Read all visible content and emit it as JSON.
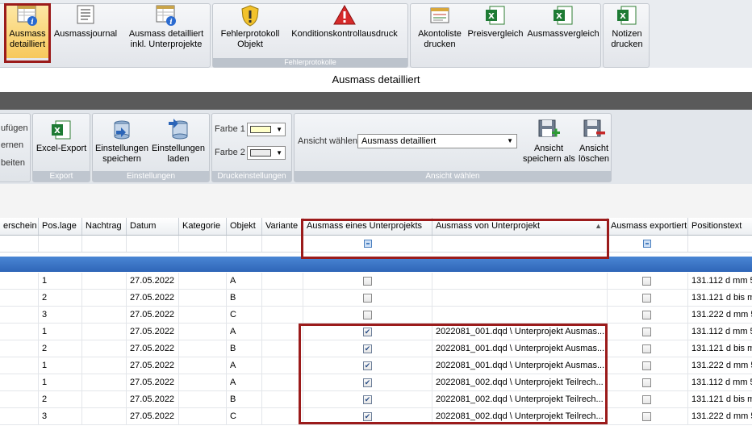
{
  "ribbon_top": {
    "buttons": [
      {
        "id": "ausmass-detailliert",
        "label": "Ausmass\ndetailliert",
        "icon": "report-info-icon",
        "selected": true
      },
      {
        "id": "ausmassjournal",
        "label": "Ausmassjournal",
        "icon": "journal-list-icon"
      },
      {
        "id": "ausmass-detailliert-unterprojekte",
        "label": "Ausmass detailliert\ninkl. Unterprojekte",
        "icon": "report-info-icon"
      },
      {
        "id": "fehlerprotokoll-objekt",
        "label": "Fehlerprotokoll\nObjekt",
        "icon": "warning-shield-icon"
      },
      {
        "id": "konditionskontrollausdruck",
        "label": "Konditionskontrollausdruck",
        "icon": "warning-triangle-icon"
      },
      {
        "id": "akontoliste-drucken",
        "label": "Akontoliste\ndrucken",
        "icon": "list-print-icon"
      },
      {
        "id": "preisvergleich",
        "label": "Preisvergleich",
        "icon": "excel-icon"
      },
      {
        "id": "ausmassvergleich",
        "label": "Ausmassvergleich",
        "icon": "excel-icon"
      },
      {
        "id": "notizen-drucken",
        "label": "Notizen\ndrucken",
        "icon": "excel-icon"
      }
    ],
    "group_titles": {
      "fehlerprotokolle": "Fehlerprotokolle"
    }
  },
  "view_title": "Ausmass detailliert",
  "ribbon_second": {
    "partial_items": [
      "ufügen",
      "ernen",
      "beiten"
    ],
    "export": {
      "button": "Excel-Export",
      "group": "Export"
    },
    "einstellungen": {
      "save": "Einstellungen\nspeichern",
      "load": "Einstellungen\nladen",
      "group": "Einstellungen"
    },
    "druck": {
      "farbe1": "Farbe 1",
      "farbe2": "Farbe 2",
      "group": "Druckeinstellungen",
      "color1": "#ffffc8",
      "color2": "#ececec"
    },
    "ansicht": {
      "label": "Ansicht wählen",
      "selected": "Ausmass detailliert",
      "save": "Ansicht\nspeichern als",
      "delete": "Ansicht\nlöschen",
      "group": "Ansicht wählen"
    }
  },
  "grid": {
    "columns": [
      "erschein",
      "Pos.lage",
      "Nachtrag",
      "Datum",
      "Kategorie",
      "Objekt",
      "Variante",
      "Ausmass eines Unterprojekts",
      "Ausmass von Unterprojekt",
      "Ausmass exportiert",
      "Positionstext"
    ],
    "rows": [
      {
        "pos": "1",
        "datum": "27.05.2022",
        "objekt": "A",
        "unter": false,
        "von": "",
        "export": false,
        "text": "131.112 d mm 5"
      },
      {
        "pos": "2",
        "datum": "27.05.2022",
        "objekt": "B",
        "unter": false,
        "von": "",
        "export": false,
        "text": "131.121 d bis m"
      },
      {
        "pos": "3",
        "datum": "27.05.2022",
        "objekt": "C",
        "unter": false,
        "von": "",
        "export": false,
        "text": "131.222 d mm 5"
      },
      {
        "pos": "1",
        "datum": "27.05.2022",
        "objekt": "A",
        "unter": true,
        "von": "2022081_001.dqd \\ Unterprojekt Ausmas...",
        "export": false,
        "text": "131.112 d mm 5"
      },
      {
        "pos": "2",
        "datum": "27.05.2022",
        "objekt": "B",
        "unter": true,
        "von": "2022081_001.dqd \\ Unterprojekt Ausmas...",
        "export": false,
        "text": "131.121 d bis m"
      },
      {
        "pos": "1",
        "datum": "27.05.2022",
        "objekt": "A",
        "unter": true,
        "von": "2022081_001.dqd \\ Unterprojekt Ausmas...",
        "export": false,
        "text": "131.222 d mm 5"
      },
      {
        "pos": "1",
        "datum": "27.05.2022",
        "objekt": "A",
        "unter": true,
        "von": "2022081_002.dqd \\ Unterprojekt Teilrech...",
        "export": false,
        "text": "131.112 d mm 5"
      },
      {
        "pos": "2",
        "datum": "27.05.2022",
        "objekt": "B",
        "unter": true,
        "von": "2022081_002.dqd \\ Unterprojekt Teilrech...",
        "export": false,
        "text": "131.121 d bis m"
      },
      {
        "pos": "3",
        "datum": "27.05.2022",
        "objekt": "C",
        "unter": true,
        "von": "2022081_002.dqd \\ Unterprojekt Teilrech...",
        "export": false,
        "text": "131.222 d mm 5"
      }
    ]
  }
}
